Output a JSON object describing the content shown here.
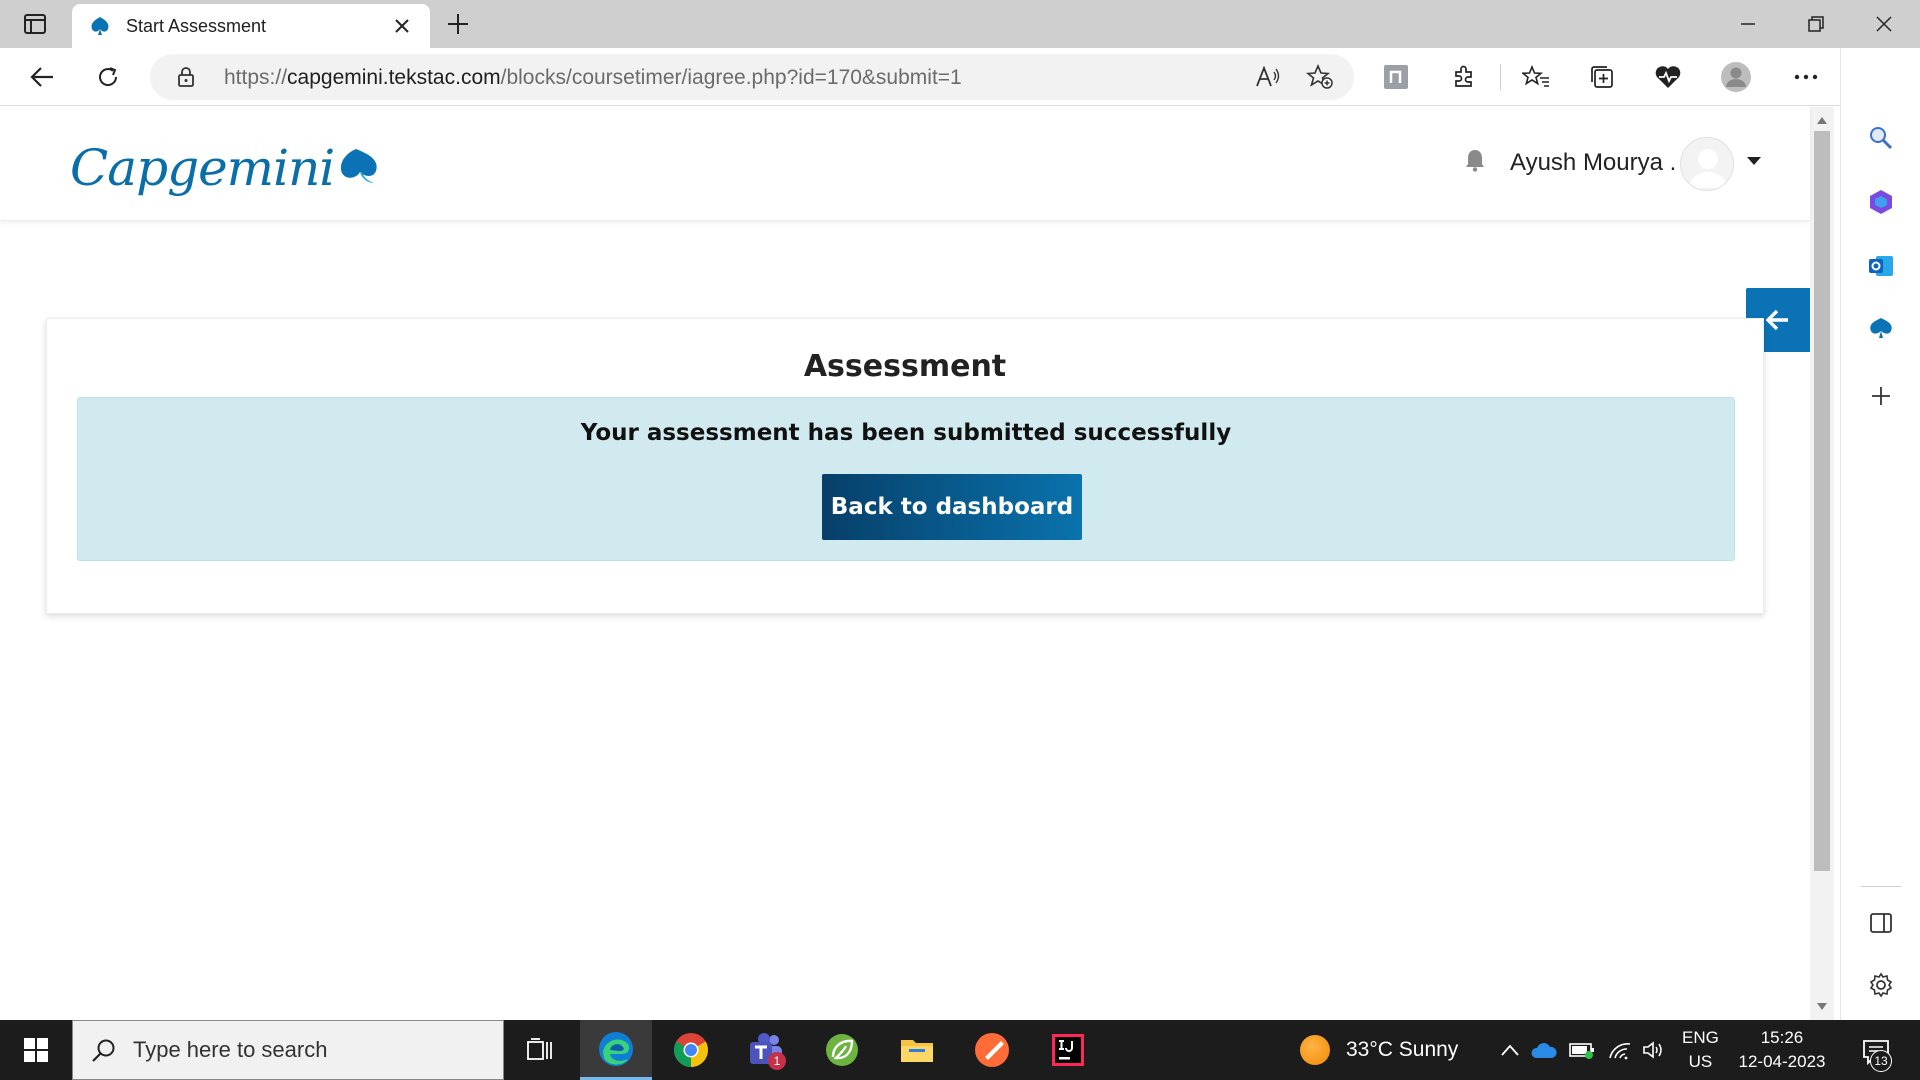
{
  "browser": {
    "tab_title": "Start Assessment",
    "url_prefix": "https://",
    "url_host": "capgemini.tekstac.com",
    "url_path": "/blocks/coursetimer/iagree.php?id=170&submit=1"
  },
  "header": {
    "logo_text": "Capgemini",
    "user_name": "Ayush Mourya ."
  },
  "card": {
    "title": "Assessment",
    "message": "Your assessment has been submitted successfully",
    "button_label": "Back to dashboard"
  },
  "taskbar": {
    "search_placeholder": "Type here to search",
    "weather": "33°C  Sunny",
    "lang_line1": "ENG",
    "lang_line2": "US",
    "time": "15:26",
    "date": "12-04-2023",
    "notification_count": "13",
    "teams_badge": "1"
  },
  "colors": {
    "brand_blue": "#0a6ea8",
    "alert_bg": "#d1eaf0",
    "button_dark": "#063f69",
    "taskbar_bg": "#1c1c1c"
  }
}
